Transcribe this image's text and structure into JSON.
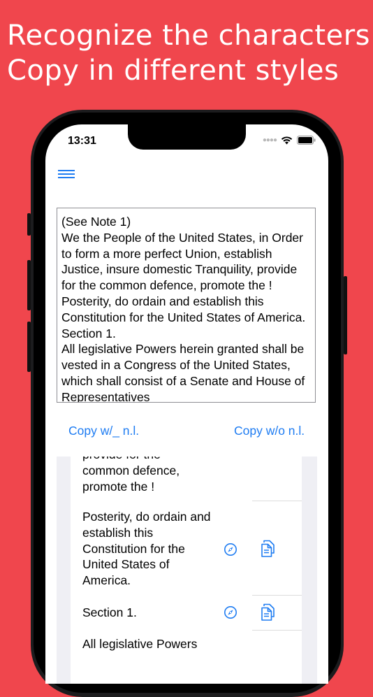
{
  "theme": {
    "background": "#F0464D",
    "accent": "#1E7CF2"
  },
  "headline": {
    "line1": "Recognize the characters",
    "line2": "Copy in different styles"
  },
  "status_bar": {
    "time": "13:31",
    "icons": [
      "signal-dots",
      "wifi-icon",
      "battery-icon"
    ]
  },
  "menu": {
    "icon": "hamburger-menu-icon"
  },
  "text_view": {
    "lines": [
      "(See Note 1)",
      "We the People of the United States, in Order",
      "to form a more perfect Union, establish",
      "Justice, insure domestic Tranquility, provide",
      "for the common defence, promote the !",
      "Posterity, do ordain and establish this",
      "Constitution for the United States of America.",
      "Section 1.",
      "All legislative Powers herein granted shall be",
      "vested in a Congress of the United States,",
      "which shall consist of a Senate and House of",
      "Representatives"
    ]
  },
  "copy_buttons": {
    "with_newline": "Copy w/_ n.l.",
    "without_newline": "Copy w/o n.l."
  },
  "sentence_list": [
    {
      "lines": [
        "provide for the",
        "common defence,",
        "promote the !"
      ]
    },
    {
      "lines": [
        "Posterity, do ordain and",
        "establish this",
        "Constitution for the",
        "United States of",
        "America."
      ],
      "actions": [
        "compass-icon",
        "copy-document-icon"
      ]
    },
    {
      "lines": [
        "Section 1."
      ],
      "actions": [
        "compass-icon",
        "copy-document-icon"
      ]
    },
    {
      "lines": [
        "All legislative Powers"
      ]
    }
  ]
}
